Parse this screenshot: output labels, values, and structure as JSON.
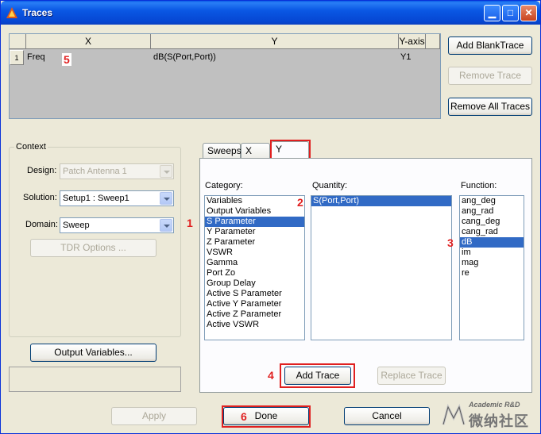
{
  "window": {
    "title": "Traces"
  },
  "grid": {
    "headers": {
      "x": "X",
      "y": "Y",
      "yaxis": "Y-axis"
    },
    "rows": [
      {
        "index": "1",
        "x": "Freq",
        "y": "dB(S(Port,Port))",
        "yaxis": "Y1"
      }
    ]
  },
  "right_buttons": {
    "add_blank": "Add BlankTrace",
    "remove": "Remove Trace",
    "remove_all": "Remove All Traces"
  },
  "context": {
    "legend": "Context",
    "design_label": "Design:",
    "design_value": "Patch Antenna 1",
    "solution_label": "Solution:",
    "solution_value": "Setup1 : Sweep1",
    "domain_label": "Domain:",
    "domain_value": "Sweep",
    "tdr_button": "TDR Options ..."
  },
  "output_variables_button": "Output Variables...",
  "tabs": [
    "Sweeps",
    "X",
    "Y"
  ],
  "category": {
    "label": "Category:",
    "items": [
      "Variables",
      "Output Variables",
      "S Parameter",
      "Y Parameter",
      "Z Parameter",
      "VSWR",
      "Gamma",
      "Port Zo",
      "Group Delay",
      "Active S Parameter",
      "Active Y Parameter",
      "Active Z Parameter",
      "Active VSWR"
    ],
    "selected": "S Parameter"
  },
  "quantity": {
    "label": "Quantity:",
    "items": [
      "S(Port,Port)"
    ],
    "selected": "S(Port,Port)"
  },
  "function": {
    "label": "Function:",
    "items": [
      "ang_deg",
      "ang_rad",
      "cang_deg",
      "cang_rad",
      "dB",
      "im",
      "mag",
      "re"
    ],
    "selected": "dB"
  },
  "panel_buttons": {
    "add_trace": "Add Trace",
    "replace_trace": "Replace Trace"
  },
  "bottom_buttons": {
    "apply": "Apply",
    "done": "Done",
    "cancel": "Cancel"
  },
  "annotations": [
    "1",
    "2",
    "3",
    "4",
    "5",
    "6"
  ],
  "watermark": {
    "line1": "Academic R&D",
    "line2": "微纳社区"
  },
  "colors": {
    "highlight": "#316ac5",
    "annotation": "#e02020",
    "titlebar": "#0a58e4"
  }
}
